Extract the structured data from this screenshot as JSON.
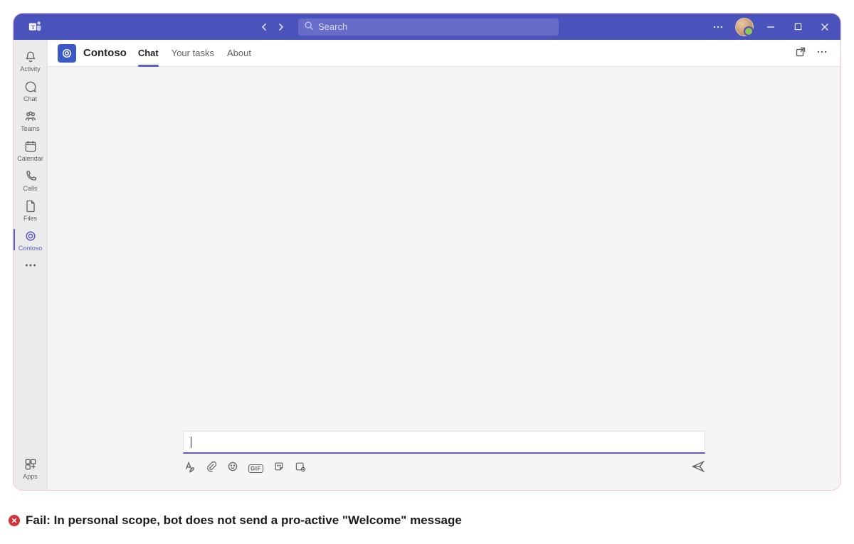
{
  "titlebar": {
    "search_placeholder": "Search"
  },
  "rail": {
    "items": [
      {
        "label": "Activity",
        "icon": "bell"
      },
      {
        "label": "Chat",
        "icon": "chat"
      },
      {
        "label": "Teams",
        "icon": "teams"
      },
      {
        "label": "Calendar",
        "icon": "calendar"
      },
      {
        "label": "Calls",
        "icon": "calls"
      },
      {
        "label": "Files",
        "icon": "files"
      },
      {
        "label": "Contoso",
        "icon": "app",
        "active": true
      }
    ],
    "apps_label": "Apps"
  },
  "header": {
    "app_name": "Contoso",
    "tabs": [
      {
        "label": "Chat",
        "active": true
      },
      {
        "label": "Your tasks",
        "active": false
      },
      {
        "label": "About",
        "active": false
      }
    ]
  },
  "caption": {
    "text": "Fail: In personal scope, bot does not send a pro-active \"Welcome\" message"
  }
}
